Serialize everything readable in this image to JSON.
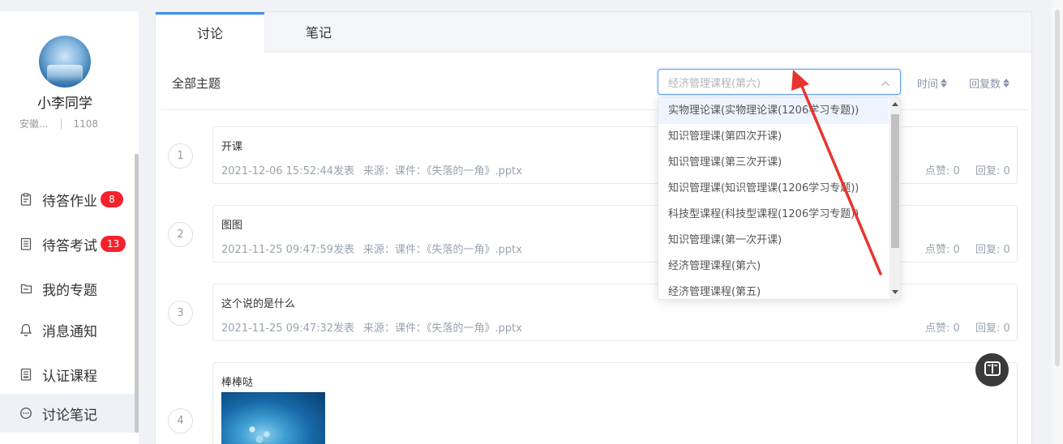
{
  "user": {
    "name": "小李同学",
    "org": "安徽...",
    "id": "1108"
  },
  "nav": [
    {
      "key": "pending-homework",
      "label": "待答作业",
      "badge": "8",
      "icon": "clipboard-icon"
    },
    {
      "key": "pending-exam",
      "label": "待答考试",
      "badge": "13",
      "icon": "exam-paper-icon"
    },
    {
      "key": "my-topics",
      "label": "我的专题",
      "badge": "",
      "icon": "folder-icon"
    },
    {
      "key": "notifications",
      "label": "消息通知",
      "badge": "",
      "icon": "bell-icon"
    },
    {
      "key": "certified-courses",
      "label": "认证课程",
      "badge": "",
      "icon": "certificate-icon"
    },
    {
      "key": "discussion-notes",
      "label": "讨论笔记",
      "badge": "",
      "icon": "chat-bubble-icon",
      "active": true
    }
  ],
  "tabs": [
    {
      "label": "讨论",
      "active": true
    },
    {
      "label": "笔记",
      "active": false
    }
  ],
  "filter": {
    "all_topics_label": "全部主题",
    "selected_course": "经济管理课程(第六)",
    "sort_time_label": "时间",
    "sort_replies_label": "回复数"
  },
  "dropdown_options": [
    "实物理论课(实物理论课(1206学习专题))",
    "知识管理课(第四次开课)",
    "知识管理课(第三次开课)",
    "知识管理课(知识管理课(1206学习专题))",
    "科技型课程(科技型课程(1206学习专题))",
    "知识管理课(第一次开课)",
    "经济管理课程(第六)",
    "经济管理课程(第五)"
  ],
  "posts": [
    {
      "num": "1",
      "title": "开课",
      "date": "2021-12-06 15:52:44发表",
      "source": "来源：课件：《失落的一角》.pptx",
      "likes": "点赞: 0",
      "replies": "回复: 0"
    },
    {
      "num": "2",
      "title": "图图",
      "date": "2021-11-25 09:47:59发表",
      "source": "来源：课件：《失落的一角》.pptx",
      "likes": "点赞: 0",
      "replies": "回复: 0"
    },
    {
      "num": "3",
      "title": "这个说的是什么",
      "date": "2021-11-25 09:47:32发表",
      "source": "来源：课件：《失落的一角》.pptx",
      "likes": "点赞: 0",
      "replies": "回复: 0"
    },
    {
      "num": "4",
      "title": "棒棒哒",
      "has_image": true
    }
  ],
  "colors": {
    "accent": "#3d8ff0",
    "badge": "#f5222d",
    "annotation_arrow": "#e8342e"
  },
  "icons": {
    "select_chevron": "chevron-up-icon",
    "reader": "open-book-icon"
  }
}
